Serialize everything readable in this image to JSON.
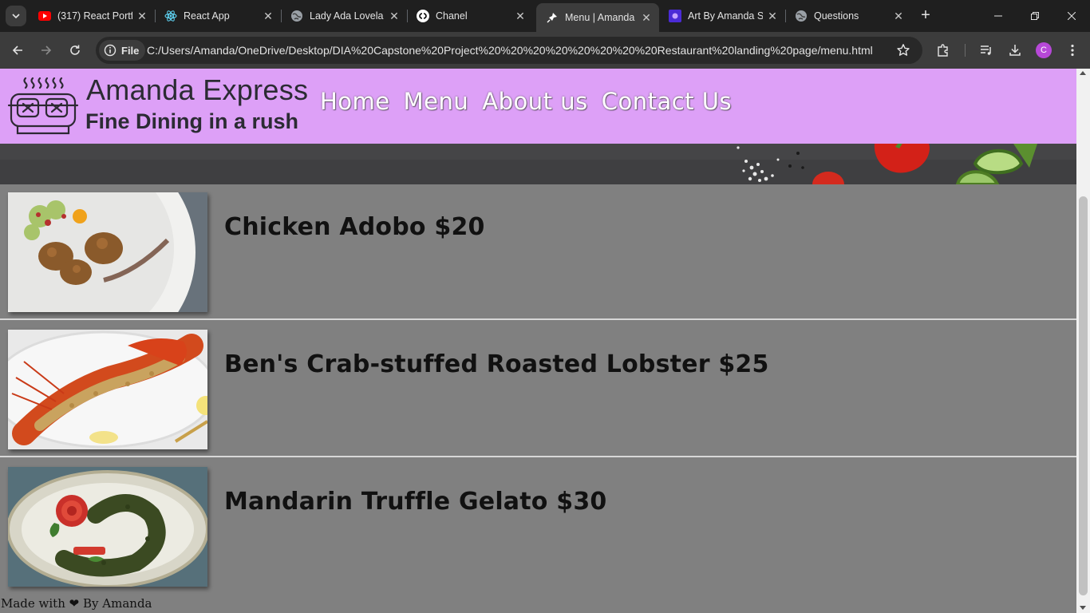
{
  "browser": {
    "tabs": [
      {
        "title": "(317) React Portf",
        "icon": "youtube-icon",
        "active": false
      },
      {
        "title": "React App",
        "icon": "react-icon",
        "active": false
      },
      {
        "title": "Lady Ada Lovela",
        "icon": "globe-icon",
        "active": false
      },
      {
        "title": "Chanel",
        "icon": "chanel-icon",
        "active": false
      },
      {
        "title": "Menu | Amanda",
        "icon": "pin-icon",
        "active": true
      },
      {
        "title": "Art By Amanda S",
        "icon": "art-icon",
        "active": false
      },
      {
        "title": "Questions",
        "icon": "globe-icon",
        "active": false
      }
    ],
    "site_chip_label": "File",
    "url": "C:/Users/Amanda/OneDrive/Desktop/DIA%20Capstone%20Project%20%20%20%20%20%20%20%20Restaurant%20landing%20page/menu.html",
    "profile_initial": "C",
    "accent": "#b748d8"
  },
  "site": {
    "brand_name": "Amanda Express",
    "tagline": "Fine Dining in a rush",
    "header_color": "#dda0f7",
    "nav": [
      "Home",
      "Menu",
      "About us",
      "Contact Us"
    ]
  },
  "menu": [
    {
      "name": "Chicken Adobo $20",
      "image": "fried-chicken-plate-image"
    },
    {
      "name": "Ben's Crab-stuffed Roasted Lobster $25",
      "image": "roasted-lobster-plate-image"
    },
    {
      "name": "Mandarin Truffle Gelato $30",
      "image": "tomato-rose-plate-image"
    }
  ],
  "footer": {
    "before": "Made with",
    "after": "By Amanda"
  }
}
